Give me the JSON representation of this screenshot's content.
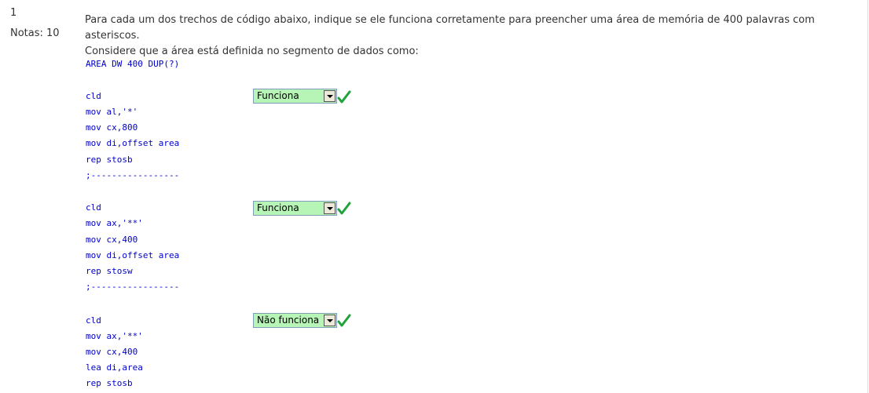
{
  "question": {
    "number": "1",
    "grade": "Notas: 10",
    "text_line1": "Para cada um dos trechos de código abaixo, indique se ele funciona corretamente para preencher uma área de memória de 400 palavras com asteriscos.",
    "text_line2": "Considere que a área está definida no segmento de dados como:",
    "definition": "AREA DW 400 DUP(?)"
  },
  "snippets": [
    {
      "lines": [
        "cld",
        "mov al,'*'",
        "mov cx,800",
        "mov di,offset area",
        "rep stosb",
        ";-----------------"
      ],
      "answer": "Funciona",
      "correct_icon": "check-icon"
    },
    {
      "lines": [
        "cld",
        "mov ax,'**'",
        "mov cx,400",
        "mov di,offset area",
        "rep stosw",
        ";-----------------"
      ],
      "answer": "Funciona",
      "correct_icon": "check-icon"
    },
    {
      "lines": [
        "cld",
        "mov ax,'**'",
        "mov cx,400",
        "lea di,area",
        "rep stosb"
      ],
      "answer": "Não funciona",
      "correct_icon": "check-icon"
    }
  ],
  "colors": {
    "code": "#0000cc",
    "correct_bg": "#b6f5b6",
    "check": "#1fa33a"
  }
}
